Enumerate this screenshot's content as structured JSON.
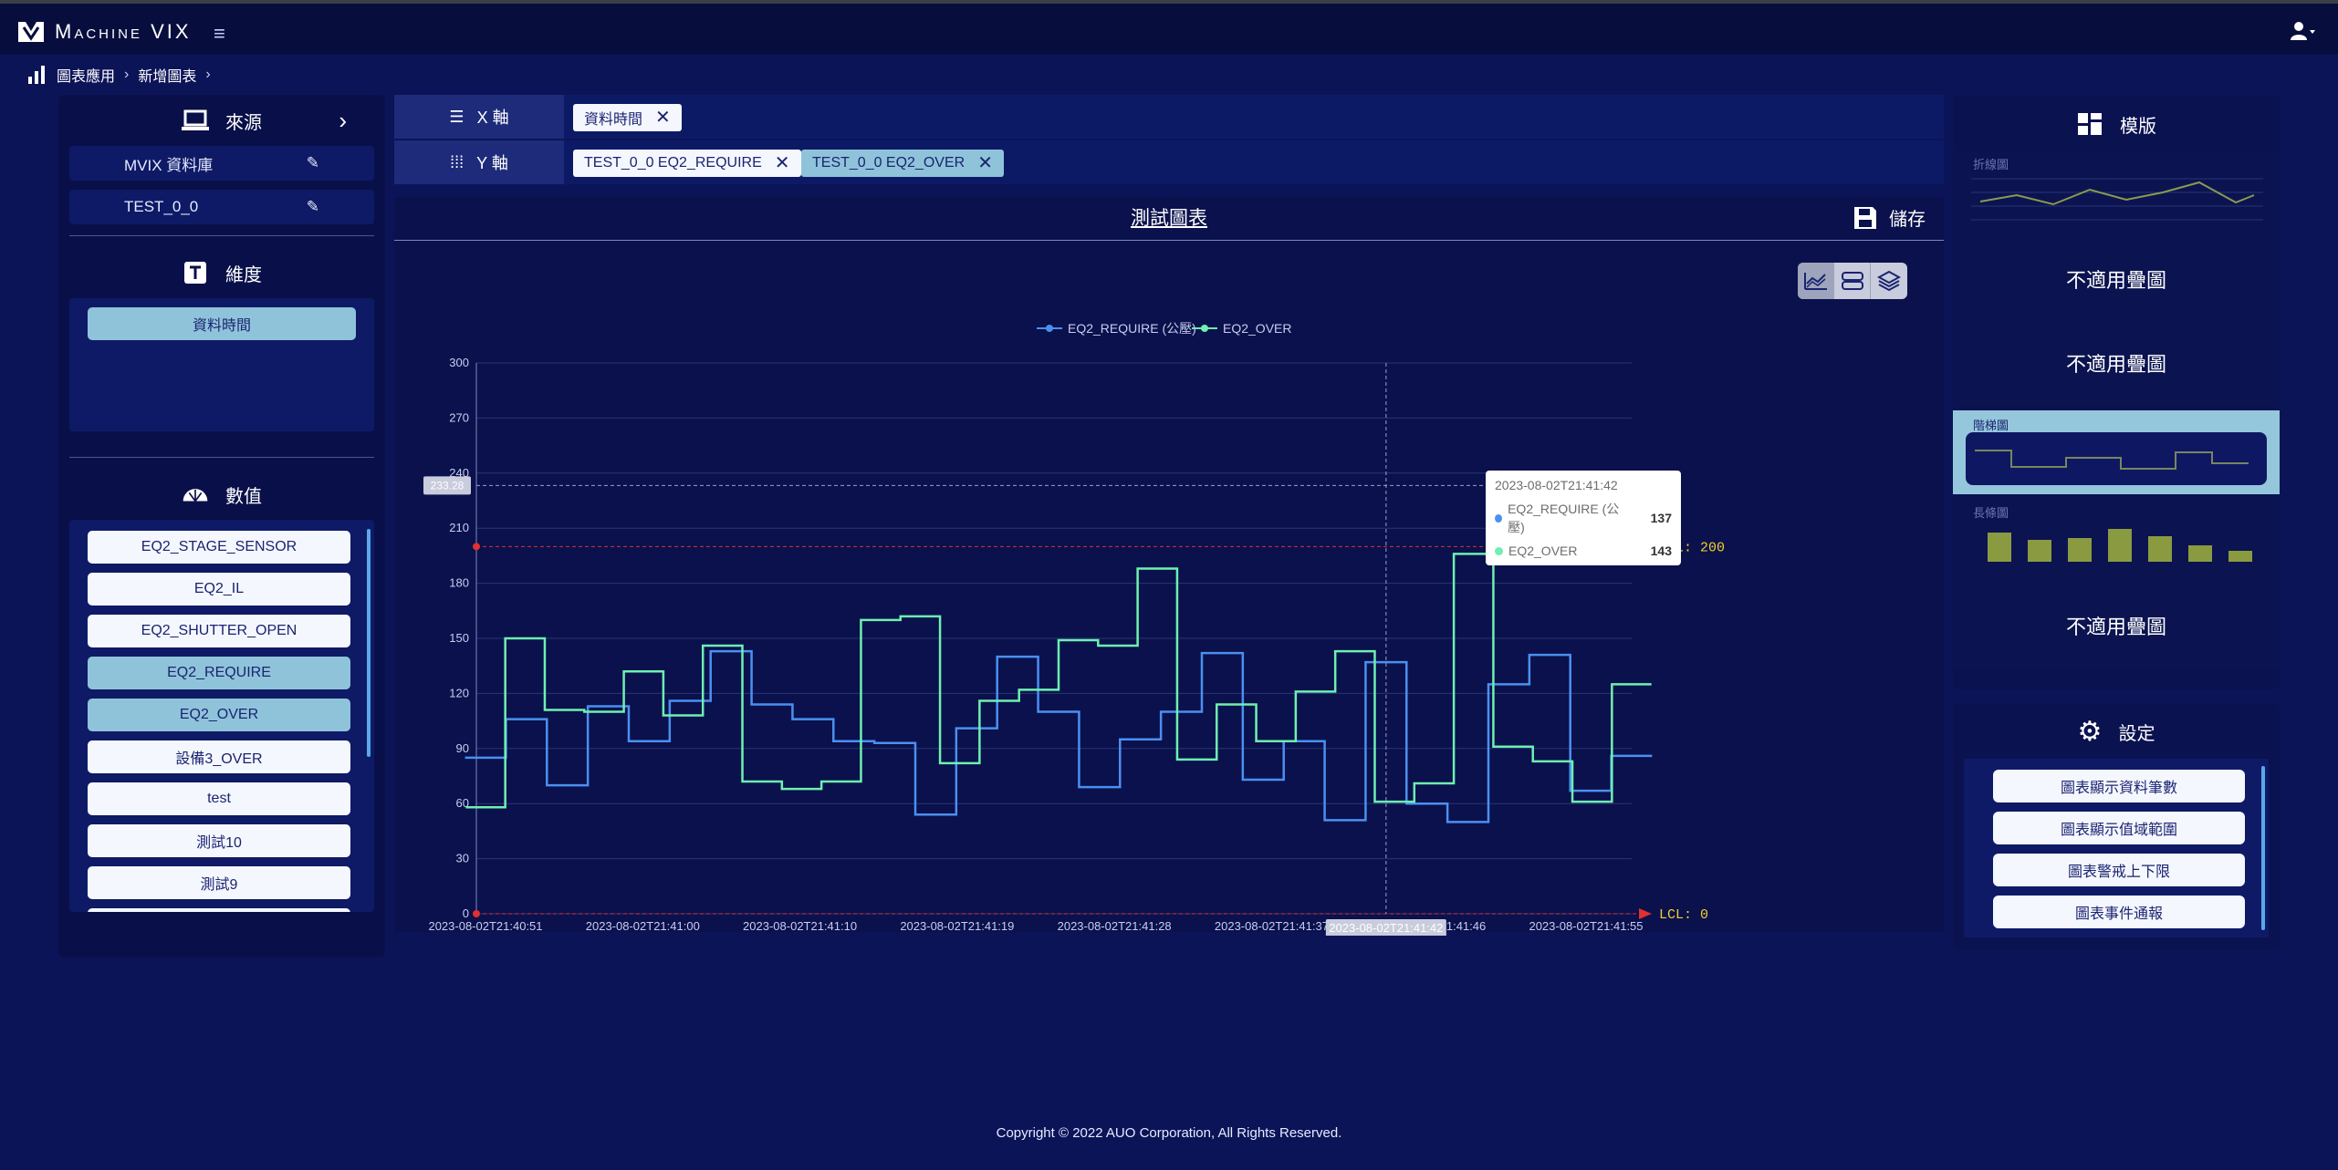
{
  "app": {
    "title": "Machine VIX"
  },
  "breadcrumb": [
    "圖表應用",
    "新增圖表"
  ],
  "left": {
    "source_title": "來源",
    "sources": [
      "MVIX 資料庫",
      "TEST_0_0"
    ],
    "dimension_title": "維度",
    "dimensions": [
      "資料時間"
    ],
    "value_title": "數值",
    "values": [
      {
        "label": "EQ2_STAGE_SENSOR",
        "selected": false
      },
      {
        "label": "EQ2_IL",
        "selected": false
      },
      {
        "label": "EQ2_SHUTTER_OPEN",
        "selected": false
      },
      {
        "label": "EQ2_REQUIRE",
        "selected": true
      },
      {
        "label": "EQ2_OVER",
        "selected": true
      },
      {
        "label": "設備3_OVER",
        "selected": false
      },
      {
        "label": "test",
        "selected": false
      },
      {
        "label": "測試10",
        "selected": false
      },
      {
        "label": "測試9",
        "selected": false
      },
      {
        "label": "",
        "selected": false
      }
    ]
  },
  "axes": {
    "x_label": "X 軸",
    "x_chips": [
      "資料時間"
    ],
    "y_label": "Y 軸",
    "y_chips": [
      "TEST_0_0 EQ2_REQUIRE",
      "TEST_0_0 EQ2_OVER"
    ]
  },
  "chart_panel": {
    "title": "測試圖表",
    "save_label": "儲存"
  },
  "chart_data": {
    "type": "line",
    "step": true,
    "legend_position": "top-center",
    "x": [
      "2023-08-02T21:40:51",
      "2023-08-02T21:40:54",
      "2023-08-02T21:40:57",
      "2023-08-02T21:41:00",
      "2023-08-02T21:41:03",
      "2023-08-02T21:41:06",
      "2023-08-02T21:41:10",
      "2023-08-02T21:41:13",
      "2023-08-02T21:41:16",
      "2023-08-02T21:41:19",
      "2023-08-02T21:41:22",
      "2023-08-02T21:41:25",
      "2023-08-02T21:41:28",
      "2023-08-02T21:41:31",
      "2023-08-02T21:41:34",
      "2023-08-02T21:41:37",
      "2023-08-02T21:41:40",
      "2023-08-02T21:41:42",
      "2023-08-02T21:41:44",
      "2023-08-02T21:41:46",
      "2023-08-02T21:41:48",
      "2023-08-02T21:41:50",
      "2023-08-02T21:41:52",
      "2023-08-02T21:41:55"
    ],
    "x_tick_labels": [
      "2023-08-02T21:40:51",
      "2023-08-02T21:41:00",
      "2023-08-02T21:41:10",
      "2023-08-02T21:41:19",
      "2023-08-02T21:41:28",
      "2023-08-02T21:41:37",
      "2023-08-02T21:41:46",
      "2023-08-02T21:41:55"
    ],
    "x_tick_index": [
      0,
      3,
      6,
      9,
      12,
      15,
      19,
      23
    ],
    "series": [
      {
        "name": "EQ2_REQUIRE (公壓)",
        "color": "#4a90f0",
        "values": [
          85,
          106,
          70,
          113,
          94,
          116,
          143,
          114,
          106,
          94,
          93,
          54,
          101,
          140,
          110,
          69,
          95,
          110,
          142,
          73,
          94,
          51,
          137,
          60,
          50,
          125,
          141,
          67,
          86
        ]
      },
      {
        "name": "EQ2_OVER",
        "color": "#6ef0b0",
        "values": [
          58,
          150,
          111,
          110,
          132,
          108,
          146,
          72,
          68,
          72,
          160,
          162,
          82,
          116,
          122,
          149,
          146,
          188,
          84,
          114,
          94,
          121,
          143,
          61,
          71,
          196,
          91,
          83,
          61,
          125
        ]
      }
    ],
    "ylim": [
      0,
      300
    ],
    "yticks": [
      0,
      30,
      60,
      90,
      120,
      150,
      180,
      210,
      240,
      270,
      300
    ],
    "ucl": {
      "label": "UCL: 200",
      "value": 200
    },
    "lcl": {
      "label": "LCL: 0",
      "value": 0
    },
    "cursor_value_label": "233.28",
    "cursor_value": 233.28,
    "tooltip": {
      "time": "2023-08-02T21:41:42",
      "rows": [
        {
          "name": "EQ2_REQUIRE (公壓)",
          "value": "137"
        },
        {
          "name": "EQ2_OVER",
          "value": "143"
        }
      ]
    },
    "highlight_x_label": "2023-08-02T21:41:42",
    "highlight_index": 22
  },
  "templates": {
    "title": "模版",
    "items": [
      {
        "label": "折線圖",
        "na": ""
      },
      {
        "label": "",
        "na": "不適用疊圖"
      },
      {
        "label": "",
        "na": "不適用疊圖"
      },
      {
        "label": "階梯圖",
        "na": "",
        "selected": true
      },
      {
        "label": "長條圖",
        "na": ""
      },
      {
        "label": "",
        "na": "不適用疊圖"
      }
    ]
  },
  "settings": {
    "title": "設定",
    "buttons": [
      "圖表顯示資料筆數",
      "圖表顯示值域範圍",
      "圖表警戒上下限",
      "圖表事件通報"
    ]
  },
  "footer": "Copyright © 2022 AUO Corporation, All Rights Reserved."
}
